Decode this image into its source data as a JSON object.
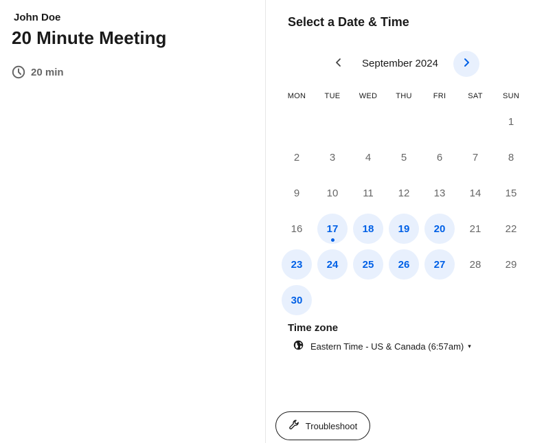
{
  "event": {
    "host": "John Doe",
    "title": "20 Minute Meeting",
    "duration": "20 min",
    "duration_icon": "clock-icon"
  },
  "scheduler": {
    "heading": "Select a Date & Time",
    "month_label": "September 2024",
    "prev_icon": "chevron-left-icon",
    "next_icon": "chevron-right-icon",
    "weekdays": [
      "MON",
      "TUE",
      "WED",
      "THU",
      "FRI",
      "SAT",
      "SUN"
    ],
    "leading_blanks": 6,
    "days": [
      {
        "d": "1",
        "available": false
      },
      {
        "d": "2",
        "available": false
      },
      {
        "d": "3",
        "available": false
      },
      {
        "d": "4",
        "available": false
      },
      {
        "d": "5",
        "available": false
      },
      {
        "d": "6",
        "available": false
      },
      {
        "d": "7",
        "available": false
      },
      {
        "d": "8",
        "available": false
      },
      {
        "d": "9",
        "available": false
      },
      {
        "d": "10",
        "available": false
      },
      {
        "d": "11",
        "available": false
      },
      {
        "d": "12",
        "available": false
      },
      {
        "d": "13",
        "available": false
      },
      {
        "d": "14",
        "available": false
      },
      {
        "d": "15",
        "available": false
      },
      {
        "d": "16",
        "available": false
      },
      {
        "d": "17",
        "available": true,
        "today": true
      },
      {
        "d": "18",
        "available": true
      },
      {
        "d": "19",
        "available": true
      },
      {
        "d": "20",
        "available": true
      },
      {
        "d": "21",
        "available": false
      },
      {
        "d": "22",
        "available": false
      },
      {
        "d": "23",
        "available": true
      },
      {
        "d": "24",
        "available": true
      },
      {
        "d": "25",
        "available": true
      },
      {
        "d": "26",
        "available": true
      },
      {
        "d": "27",
        "available": true
      },
      {
        "d": "28",
        "available": false
      },
      {
        "d": "29",
        "available": false
      },
      {
        "d": "30",
        "available": true
      }
    ]
  },
  "timezone": {
    "label": "Time zone",
    "value": "Eastern Time - US & Canada (6:57am)",
    "icon": "globe-icon",
    "caret": "▾"
  },
  "troubleshoot": {
    "label": "Troubleshoot",
    "icon": "wrench-icon"
  },
  "colors": {
    "accent": "#0060e6",
    "available_bg": "#e8f0fd",
    "muted_text": "#666666"
  }
}
